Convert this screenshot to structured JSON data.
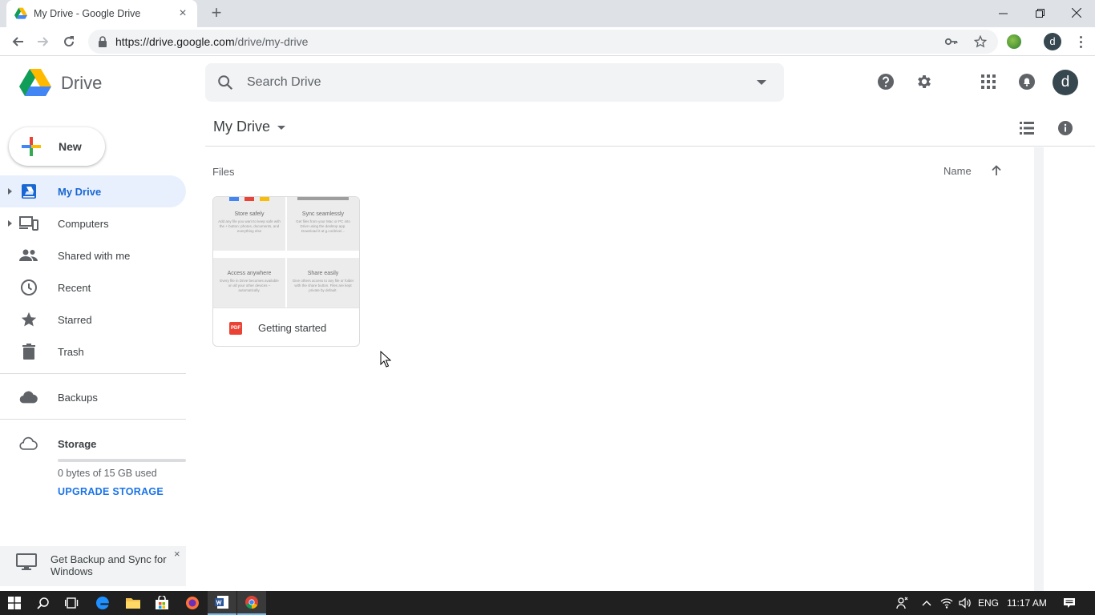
{
  "browser": {
    "tab_title": "My Drive - Google Drive",
    "tab_close": "×",
    "new_tab": "+",
    "url_host": "https://drive.google.com",
    "url_path": "/drive/my-drive",
    "profile_initial": "d"
  },
  "header": {
    "app_name": "Drive",
    "search_placeholder": "Search Drive",
    "avatar_initial": "d"
  },
  "sidebar": {
    "new_label": "New",
    "items": [
      {
        "label": "My Drive",
        "icon": "my-drive-icon",
        "active": true
      },
      {
        "label": "Computers",
        "icon": "computers-icon"
      },
      {
        "label": "Shared with me",
        "icon": "people-icon"
      },
      {
        "label": "Recent",
        "icon": "clock-icon"
      },
      {
        "label": "Starred",
        "icon": "star-icon"
      },
      {
        "label": "Trash",
        "icon": "trash-icon"
      }
    ],
    "backups_label": "Backups",
    "storage_label": "Storage",
    "storage_used": "0 bytes of 15 GB used",
    "storage_fraction": 0,
    "upgrade_label": "UPGRADE STORAGE",
    "promo_text": "Get Backup and Sync for Windows",
    "promo_close": "×"
  },
  "main": {
    "title": "My Drive",
    "section_label": "Files",
    "sort_label": "Name",
    "files": [
      {
        "name": "Getting started",
        "type_badge": "PDF",
        "thumbnail": {
          "panels": [
            {
              "title": "Store safely",
              "body": "Add any file you want to keep safe with the + button: photos, documents, and everything else"
            },
            {
              "title": "Sync seamlessly",
              "body": "Get files from your Mac or PC into Drive using the desktop app. Download it at g.co/drive/..."
            },
            {
              "title": "Access anywhere",
              "body": "Every file in Drive becomes available on all your other devices – automatically."
            },
            {
              "title": "Share easily",
              "body": "Give others access to any file or folder with the share button. Files are kept private by default."
            }
          ]
        }
      }
    ]
  },
  "taskbar": {
    "language": "ENG",
    "time": "11:17 AM"
  },
  "colors": {
    "accent": "#1a73e8",
    "active_nav_bg": "#e8f0fe",
    "avatar_bg": "#37474f",
    "taskbar_bg": "#202020"
  }
}
